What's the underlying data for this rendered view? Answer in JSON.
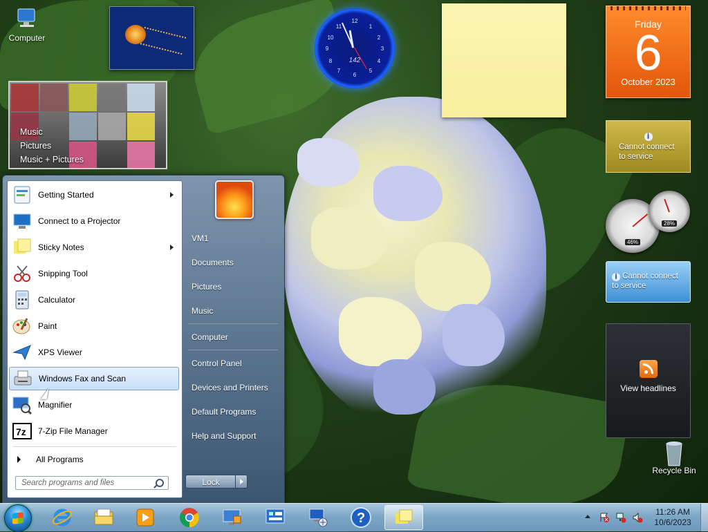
{
  "desktop": {
    "icons": [
      {
        "label": "Computer",
        "icon": "computer-icon"
      },
      {
        "label": "Recycle Bin",
        "icon": "recycle-bin-icon"
      }
    ]
  },
  "gadgets": {
    "media_center": {
      "items": [
        "Music",
        "Pictures",
        "Music + Pictures"
      ]
    },
    "clock": {
      "label": "142"
    },
    "calendar": {
      "day": "Friday",
      "date": "6",
      "month": "October 2023"
    },
    "currency": {
      "message": "Cannot connect to service"
    },
    "cpu_meter": {
      "cpu_percent": "46%",
      "memory_percent": "28%"
    },
    "weather": {
      "message": "Cannot connect to service"
    },
    "feed_headlines": {
      "label": "View headlines"
    }
  },
  "start_menu": {
    "programs": [
      {
        "label": "Getting Started",
        "icon": "getting-started-icon",
        "has_submenu": true
      },
      {
        "label": "Connect to a Projector",
        "icon": "projector-icon",
        "has_submenu": false
      },
      {
        "label": "Sticky Notes",
        "icon": "sticky-notes-icon",
        "has_submenu": true
      },
      {
        "label": "Snipping Tool",
        "icon": "snipping-tool-icon",
        "has_submenu": false
      },
      {
        "label": "Calculator",
        "icon": "calculator-icon",
        "has_submenu": false
      },
      {
        "label": "Paint",
        "icon": "paint-icon",
        "has_submenu": false
      },
      {
        "label": "XPS Viewer",
        "icon": "xps-viewer-icon",
        "has_submenu": false
      },
      {
        "label": "Windows Fax and Scan",
        "icon": "fax-scan-icon",
        "has_submenu": false,
        "highlighted": true
      },
      {
        "label": "Magnifier",
        "icon": "magnifier-icon",
        "has_submenu": false
      },
      {
        "label": "7-Zip File Manager",
        "icon": "7zip-icon",
        "has_submenu": false
      }
    ],
    "all_programs": "All Programs",
    "search_placeholder": "Search programs and files",
    "right_items": [
      "VM1",
      "Documents",
      "Pictures",
      "Music",
      "Computer",
      "Control Panel",
      "Devices and Printers",
      "Default Programs",
      "Help and Support"
    ],
    "lock_label": "Lock"
  },
  "taskbar": {
    "pinned": [
      {
        "icon": "internet-explorer-icon"
      },
      {
        "icon": "file-explorer-icon"
      },
      {
        "icon": "media-player-icon"
      },
      {
        "icon": "chrome-icon"
      },
      {
        "icon": "remote-desktop-icon"
      },
      {
        "icon": "control-panel-icon"
      },
      {
        "icon": "network-icon"
      },
      {
        "icon": "help-icon"
      },
      {
        "icon": "sticky-notes-taskbar-icon",
        "active": true
      }
    ],
    "time": "11:26 AM",
    "date": "10/6/2023"
  },
  "colors": {
    "taskbar": "#7ea7c6",
    "calendar": "#e3560b",
    "highlight": "#c9e0f7"
  }
}
